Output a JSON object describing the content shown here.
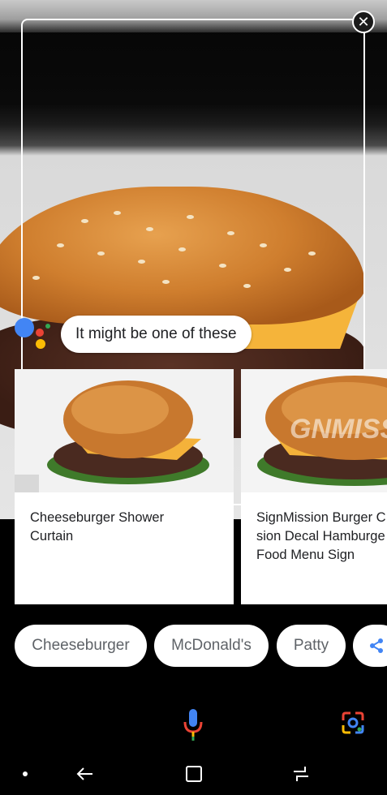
{
  "assistant": {
    "bubble_text": "It might be one of these"
  },
  "results": [
    {
      "title": "Cheeseburger Shower\nCurtain"
    },
    {
      "title": "SignMission Burger C\nsion Decal Hamburge\nFood Menu Sign"
    }
  ],
  "chips": [
    {
      "label": "Cheeseburger"
    },
    {
      "label": "McDonald's"
    },
    {
      "label": "Patty"
    }
  ],
  "icons": {
    "close": "close-icon",
    "share": "share-icon",
    "mic": "microphone-icon",
    "lens": "lens-icon",
    "nav_dot": "nav-dot-icon",
    "back": "back-icon",
    "home": "home-icon",
    "recents": "recents-icon"
  },
  "colors": {
    "google_blue": "#4285F4",
    "google_red": "#EA4335",
    "google_yellow": "#FBBC05",
    "google_green": "#34A853"
  }
}
